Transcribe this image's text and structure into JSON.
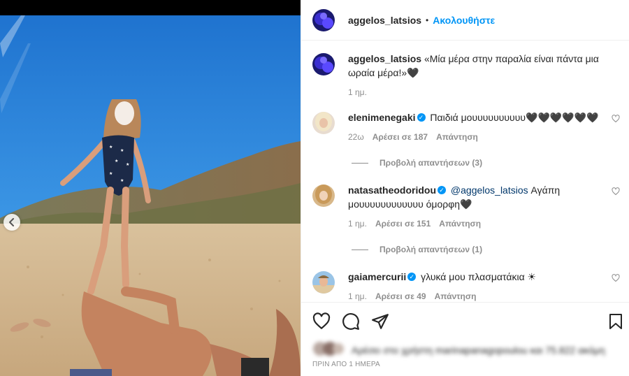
{
  "post": {
    "author": "aggelos_latsios",
    "separator": "•",
    "follow_label": "Ακολουθήστε"
  },
  "caption": {
    "user": "aggelos_latsios",
    "text": "«Μία μέρα στην παραλία είναι πάντα μια ωραία μέρα!»",
    "emoji": "🖤",
    "time": "1 ημ."
  },
  "comments": [
    {
      "user": "elenimenegaki",
      "verified": true,
      "text": "Παιδιά μουυυυυυυυυυ🖤🖤🖤🖤🖤🖤",
      "time": "22ω",
      "likes": "Αρέσει σε 187",
      "reply": "Απάντηση",
      "view_replies": "Προβολή απαντήσεων (3)"
    },
    {
      "user": "natasatheodoridou",
      "verified": true,
      "mention": "@aggelos_latsios",
      "text": " Αγάπη μουυυυυυυυυυυυ όμορφη🖤",
      "time": "1 ημ.",
      "likes": "Αρέσει σε 151",
      "reply": "Απάντηση",
      "view_replies": "Προβολή απαντήσεων (1)"
    },
    {
      "user": "gaiamercurii",
      "verified": true,
      "text": "γλυκά μου πλασματάκια ☀",
      "time": "1 ημ.",
      "likes": "Αρέσει σε 49",
      "reply": "Απάντηση"
    }
  ],
  "verified_mark": "✓",
  "likes_summary": "Αρέσει στο χρήστη marinapanagopoulou και 75.822 ακόμη",
  "timestamp": "ΠΡΙΝ ΑΠΟ 1 ΗΜΕΡΑ",
  "colors": {
    "accent": "#0095f6",
    "text": "#262626",
    "secondary": "#8e8e8e"
  },
  "icons": {
    "like": "heart-icon",
    "comment": "comment-icon",
    "share": "send-icon",
    "save": "bookmark-icon",
    "prev": "chevron-left-icon"
  }
}
